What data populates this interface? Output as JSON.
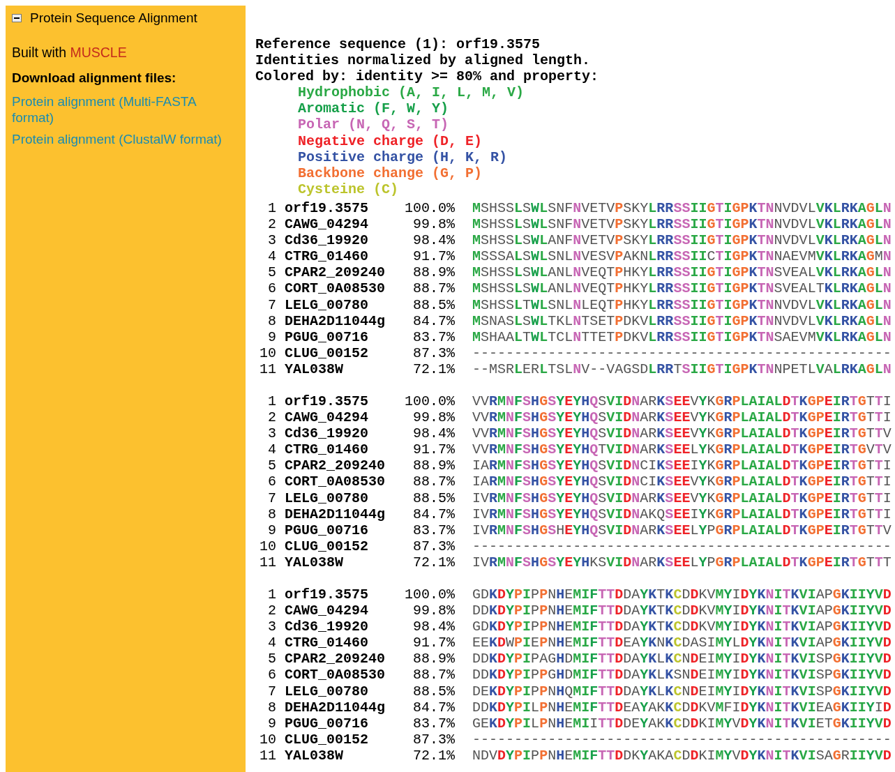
{
  "sidebar": {
    "title": "Protein Sequence Alignment",
    "expanded": true,
    "built_with": {
      "label": "Built with",
      "tool": "MUSCLE"
    },
    "downloads_heading": "Download alignment files:",
    "links": [
      "Protein alignment (Multi-FASTA format)",
      "Protein alignment (ClustalW format)"
    ]
  },
  "info": [
    "Reference sequence (1): orf19.3575",
    "Identities normalized by aligned length.",
    "Colored by: identity >= 80% and property:"
  ],
  "legend": [
    {
      "text": "Hydrophobic (A, I, L, M, V)",
      "color": "#2aa845"
    },
    {
      "text": "Aromatic (F, W, Y)",
      "color": "#17a04a"
    },
    {
      "text": "Polar (N, Q, S, T)",
      "color": "#c766b4"
    },
    {
      "text": "Negative charge (D, E)",
      "color": "#ee2227"
    },
    {
      "text": "Positive charge (H, K, R)",
      "color": "#3452a4"
    },
    {
      "text": "Backbone change (G, P)",
      "color": "#f26f32"
    },
    {
      "text": "Cysteine (C)",
      "color": "#bcc42c"
    }
  ],
  "blocks": [
    {
      "conserved": [
        true,
        false,
        false,
        false,
        false,
        true,
        false,
        true,
        true,
        false,
        false,
        false,
        true,
        false,
        false,
        false,
        false,
        true,
        false,
        false,
        false,
        true,
        true,
        true,
        true,
        true,
        true,
        true,
        true,
        true,
        true,
        true,
        true,
        true,
        true,
        true,
        false,
        false,
        false,
        false,
        false,
        true,
        true,
        true,
        true,
        true,
        true,
        true,
        true,
        true
      ],
      "rows": [
        {
          "num": "1",
          "name": "orf19.3575",
          "identity": "100.0%",
          "sequence": "MSHSSLSWLSNFNVETVPSKYLRRSSIIGTIGPKTNNVDVLVKLRKAGLN"
        },
        {
          "num": "2",
          "name": "CAWG_04294",
          "identity": "99.8%",
          "sequence": "MSHSSLSWLSNFNVETVPSKYLRRSSIIGTIGPKTNNVDVLVKLRKAGLN"
        },
        {
          "num": "3",
          "name": "Cd36_19920",
          "identity": "98.4%",
          "sequence": "MSHSSLSWLANFNVETVPSKYLRRSSIIGTIGPKTNNVDVLVKLRKAGLN"
        },
        {
          "num": "4",
          "name": "CTRG_01460",
          "identity": "91.7%",
          "sequence": "MSSSALSWLSNLNVESVPAKNLRRSSIICTIGPKTNNAEVMVKLRKAGMN"
        },
        {
          "num": "5",
          "name": "CPAR2_209240",
          "identity": "88.9%",
          "sequence": "MSHSSLSWLANLNVEQTPHKYLRRSSIIGTIGPKTNSVEALVKLRKAGLN"
        },
        {
          "num": "6",
          "name": "CORT_0A08530",
          "identity": "88.7%",
          "sequence": "MSHSSLSWLANLNVEQTPHKYLRRSSIIGTIGPKTNSVEALTKLRKAGLN"
        },
        {
          "num": "7",
          "name": "LELG_00780",
          "identity": "88.5%",
          "sequence": "MSHSSLTWLSNLNLEQTPHKYLRRSSIIGTIGPKTNNVDVLVKLRKAGLN"
        },
        {
          "num": "8",
          "name": "DEHA2D11044g",
          "identity": "84.7%",
          "sequence": "MSNASLSWLTKLNTSETPDKVLRRSSIIGTIGPKTNNVDVLVKLRKAGLN"
        },
        {
          "num": "9",
          "name": "PGUG_00716",
          "identity": "83.7%",
          "sequence": "MSHAALTWLTCLNTTETPDKVLRRSSIIGTIGPKTNSAEVMVKLRKAGLN"
        },
        {
          "num": "10",
          "name": "CLUG_00152",
          "identity": "87.3%",
          "sequence": "--------------------------------------------------"
        },
        {
          "num": "11",
          "name": "YAL038W",
          "identity": "72.1%",
          "sequence": "--MSRLERLTSLNV--VAGSDLRRTSIIGTIGPKTNNPETLVALRKAGLN"
        }
      ]
    },
    {
      "conserved": [
        false,
        false,
        true,
        true,
        true,
        true,
        true,
        true,
        true,
        true,
        true,
        true,
        true,
        true,
        true,
        false,
        true,
        true,
        true,
        true,
        false,
        false,
        true,
        true,
        true,
        true,
        false,
        true,
        false,
        true,
        true,
        true,
        true,
        true,
        true,
        true,
        true,
        true,
        true,
        true,
        true,
        true,
        true,
        true,
        true,
        true,
        true,
        false,
        true,
        false
      ],
      "rows": [
        {
          "num": "1",
          "name": "orf19.3575",
          "identity": "100.0%",
          "sequence": "VVRMNFSHGSYEYHQSVIDNARKSEEVYKGRPLAIALDTKGPEIRTGTTI"
        },
        {
          "num": "2",
          "name": "CAWG_04294",
          "identity": "99.8%",
          "sequence": "VVRMNFSHGSYEYHQSVIDNARKSEEVYKGRPLAIALDTKGPEIRTGTTI"
        },
        {
          "num": "3",
          "name": "Cd36_19920",
          "identity": "98.4%",
          "sequence": "VVRMNFSHGSYEYHQSVIDNARKSEEVYKGRPLAIALDTKGPEIRTGTTV"
        },
        {
          "num": "4",
          "name": "CTRG_01460",
          "identity": "91.7%",
          "sequence": "VVRMNFSHGSYEYHQTVIDNARKSEELYKGRPLAIALDTKGPEIRTGVTV"
        },
        {
          "num": "5",
          "name": "CPAR2_209240",
          "identity": "88.9%",
          "sequence": "IARMNFSHGSYEYHQSVIDNCIKSEEIYKGRPLAIALDTKGPEIRTGTTI"
        },
        {
          "num": "6",
          "name": "CORT_0A08530",
          "identity": "88.7%",
          "sequence": "IARMNFSHGSYEYHQSVIDNCIKSEEVYKGRPLAIALDTKGPEIRTGTTI"
        },
        {
          "num": "7",
          "name": "LELG_00780",
          "identity": "88.5%",
          "sequence": "IVRMNFSHGSYEYHQSVIDNARKSEEVYKGRPLAIALDTKGPEIRTGTTI"
        },
        {
          "num": "8",
          "name": "DEHA2D11044g",
          "identity": "84.7%",
          "sequence": "IVRMNFSHGSYEYHQSVIDNAKQSEEIYKGRPLAIALDTKGPEIRTGTTI"
        },
        {
          "num": "9",
          "name": "PGUG_00716",
          "identity": "83.7%",
          "sequence": "IVRMNFSHGSHEYHQSVIDNARKSEELYPGRPLAIALDTKGPEIRTGTTV"
        },
        {
          "num": "10",
          "name": "CLUG_00152",
          "identity": "87.3%",
          "sequence": "--------------------------------------------------"
        },
        {
          "num": "11",
          "name": "YAL038W",
          "identity": "72.1%",
          "sequence": "IVRMNFSHGSYEYHKSVIDNARKSEELYPGRPLAIALDTKGPEIRTGTTT"
        }
      ]
    },
    {
      "conserved": [
        false,
        false,
        true,
        true,
        true,
        true,
        true,
        false,
        true,
        false,
        true,
        false,
        true,
        true,
        true,
        true,
        true,
        true,
        false,
        false,
        true,
        true,
        false,
        true,
        true,
        false,
        true,
        false,
        false,
        true,
        true,
        false,
        true,
        true,
        true,
        true,
        true,
        true,
        true,
        true,
        true,
        false,
        false,
        true,
        true,
        true,
        true,
        true,
        true,
        true
      ],
      "rows": [
        {
          "num": "1",
          "name": "orf19.3575",
          "identity": "100.0%",
          "sequence": "GDKDYPIPPNHEMIFTTDDAYKTKCDDKVMYIDYKNITKVIAPGKIIYVD"
        },
        {
          "num": "2",
          "name": "CAWG_04294",
          "identity": "99.8%",
          "sequence": "DDKDYPIPPNHEMIFTTDDAYKTKCDDKVMYIDYKNITKVIAPGKIIYVD"
        },
        {
          "num": "3",
          "name": "Cd36_19920",
          "identity": "98.4%",
          "sequence": "GDKDYPIPPNHEMIFTTDDAYKTKCDDKVMYIDYKNITKVIAPGKIIYVD"
        },
        {
          "num": "4",
          "name": "CTRG_01460",
          "identity": "91.7%",
          "sequence": "EEKDWPIEPNHEMIFTTDEAYKNKCDASIMYLDYKNITKVIAPGKIIYVD"
        },
        {
          "num": "5",
          "name": "CPAR2_209240",
          "identity": "88.9%",
          "sequence": "DDKDYPIPAGHDMIFTTDDAYKLKCNDEIMYIDYKNITKVISPGKIIYVD"
        },
        {
          "num": "6",
          "name": "CORT_0A08530",
          "identity": "88.7%",
          "sequence": "DDKDYPIPPGHDMIFTTDDAYKLKSNDEIMYIDYKNITKVISPGKIIYVD"
        },
        {
          "num": "7",
          "name": "LELG_00780",
          "identity": "88.5%",
          "sequence": "DEKDYPIPPNHQMIFTTDDAYKLKCNDEIMYIDYKNITKVISPGKIIYVD"
        },
        {
          "num": "8",
          "name": "DEHA2D11044g",
          "identity": "84.7%",
          "sequence": "DDKDYPILPNHEMIFTTDEAYAKKCDDKVMFIDYKNITKVIEAGKIIYID"
        },
        {
          "num": "9",
          "name": "PGUG_00716",
          "identity": "83.7%",
          "sequence": "GEKDYPILPNHEMIITTDDEYAKKCDDKIMYVDYKNITKVIETGKIIYVD"
        },
        {
          "num": "10",
          "name": "CLUG_00152",
          "identity": "87.3%",
          "sequence": "--------------------------------------------------"
        },
        {
          "num": "11",
          "name": "YAL038W",
          "identity": "72.1%",
          "sequence": "NDVDYPIPPNHEMIFTTDDKYAKACDDKIMYVDYKNITKVISAGRIIYVD"
        }
      ]
    }
  ]
}
